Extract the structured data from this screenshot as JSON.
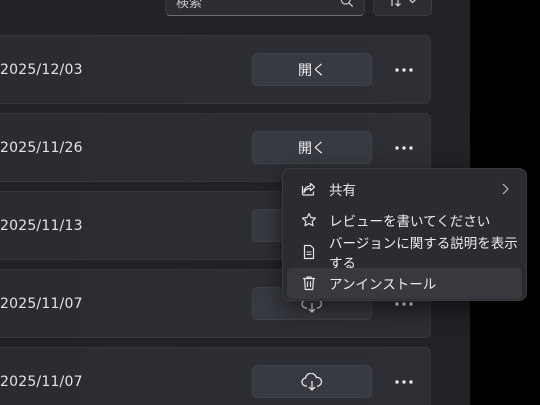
{
  "search": {
    "placeholder": "検索"
  },
  "rows": [
    {
      "date": "2025/12/03",
      "action_label": "開く",
      "action_type": "open"
    },
    {
      "date": "2025/11/26",
      "action_label": "開く",
      "action_type": "open"
    },
    {
      "date": "2025/11/13",
      "action_label": "",
      "action_type": "hidden"
    },
    {
      "date": "2025/11/07",
      "action_label": "",
      "action_type": "download"
    },
    {
      "date": "2025/11/07",
      "action_label": "",
      "action_type": "download"
    }
  ],
  "context_menu": {
    "items": [
      {
        "label": "共有",
        "icon": "share-icon",
        "submenu": true
      },
      {
        "label": "レビューを書いてください",
        "icon": "star-icon"
      },
      {
        "label": "バージョンに関する説明を表示する",
        "icon": "document-icon"
      },
      {
        "label": "アンインストール",
        "icon": "trash-icon",
        "highlighted": true
      }
    ]
  },
  "colors": {
    "background": "#202226",
    "row": "#2c2e33",
    "menu": "#2b2c30",
    "highlight": "#38393e"
  }
}
